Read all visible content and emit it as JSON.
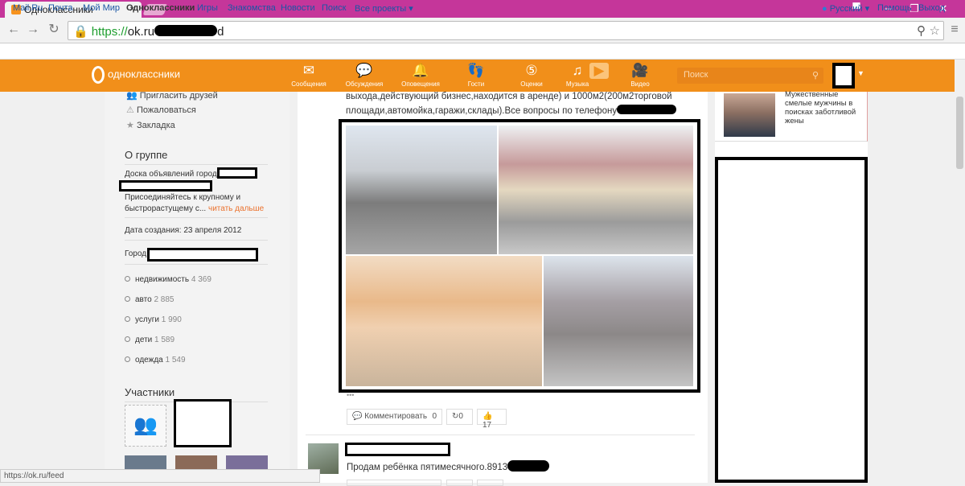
{
  "browser": {
    "tab_title": "Одноклассники",
    "url_scheme": "https://",
    "url_host": "ok.ru",
    "url_tail": "d",
    "status_url": "https://ok.ru/feed"
  },
  "services": {
    "left": [
      "Mail.Ru",
      "Почта",
      "Мой Мир",
      "Одноклассники",
      "Игры",
      "Знакомства",
      "Новости",
      "Поиск",
      "Все проекты ▾"
    ],
    "lang": "Русский ▾",
    "help": "Помощь",
    "logout": "Выход"
  },
  "ok": {
    "logo": "одноклассники",
    "nav": [
      {
        "label": "Сообщения",
        "icon": "envelope-icon"
      },
      {
        "label": "Обсуждения",
        "icon": "chat-icon"
      },
      {
        "label": "Оповещения",
        "icon": "bell-icon"
      },
      {
        "label": "Гости",
        "icon": "footprints-icon"
      },
      {
        "label": "Оценки",
        "icon": "rating-icon"
      },
      {
        "label": "Музыка",
        "icon": "music-icon"
      },
      {
        "label": "Видео",
        "icon": "video-icon"
      }
    ],
    "search_placeholder": "Поиск"
  },
  "left": {
    "links": [
      "Пригласить друзей",
      "Пожаловаться",
      "Закладка"
    ],
    "about_title": "О группе",
    "about_line1": "Доска объявлений города",
    "about_desc1": "Присоединяйтесь к крупному и",
    "about_desc2": "быстрорастущему с...",
    "read_more": "читать дальше",
    "created": "Дата создания: 23 апреля 2012",
    "city_label": "Город",
    "categories": [
      {
        "name": "недвижимость",
        "count": "4 369"
      },
      {
        "name": "авто",
        "count": "2 885"
      },
      {
        "name": "услуги",
        "count": "1 990"
      },
      {
        "name": "дети",
        "count": "1 589"
      },
      {
        "name": "одежда",
        "count": "1 549"
      }
    ],
    "members_title": "Участники"
  },
  "feed": {
    "post1_line1": "выхода,действующий бизнес,находится в аренде) и 1000м2(200м2торговой",
    "post1_line2": "площади,автомойка,гаражи,склады).Все вопросы по телефону",
    "more": "•••",
    "comment_label": "Комментировать",
    "comment_count": "0",
    "share_count": "0",
    "like_count": "17",
    "post2_text": "Продам ребёнка пятимесячного.8913"
  },
  "right": {
    "ad_text": "Мужественные смелые мужчины в поисках заботливой жены"
  }
}
